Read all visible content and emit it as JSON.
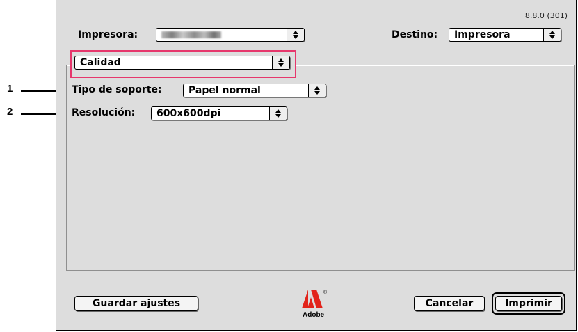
{
  "dialog": {
    "version": "8.8.0 (301)",
    "printer_label": "Impresora:",
    "destination_label": "Destino:",
    "destination_value": "Impresora",
    "section_value": "Calidad",
    "media_label": "Tipo de soporte:",
    "media_value": "Papel normal",
    "resolution_label": "Resolución:",
    "resolution_value": "600x600dpi",
    "save_button": "Guardar ajustes",
    "cancel_button": "Cancelar",
    "print_button": "Imprimir",
    "logo_text": "Adobe",
    "logo_mark": "®"
  },
  "callouts": [
    "1",
    "2"
  ],
  "colors": {
    "highlight": "#e6376c",
    "dialog_bg": "#dddddd"
  },
  "icons": {
    "popup_arrow": "updown-arrows-icon",
    "logo": "adobe-logo-icon"
  }
}
